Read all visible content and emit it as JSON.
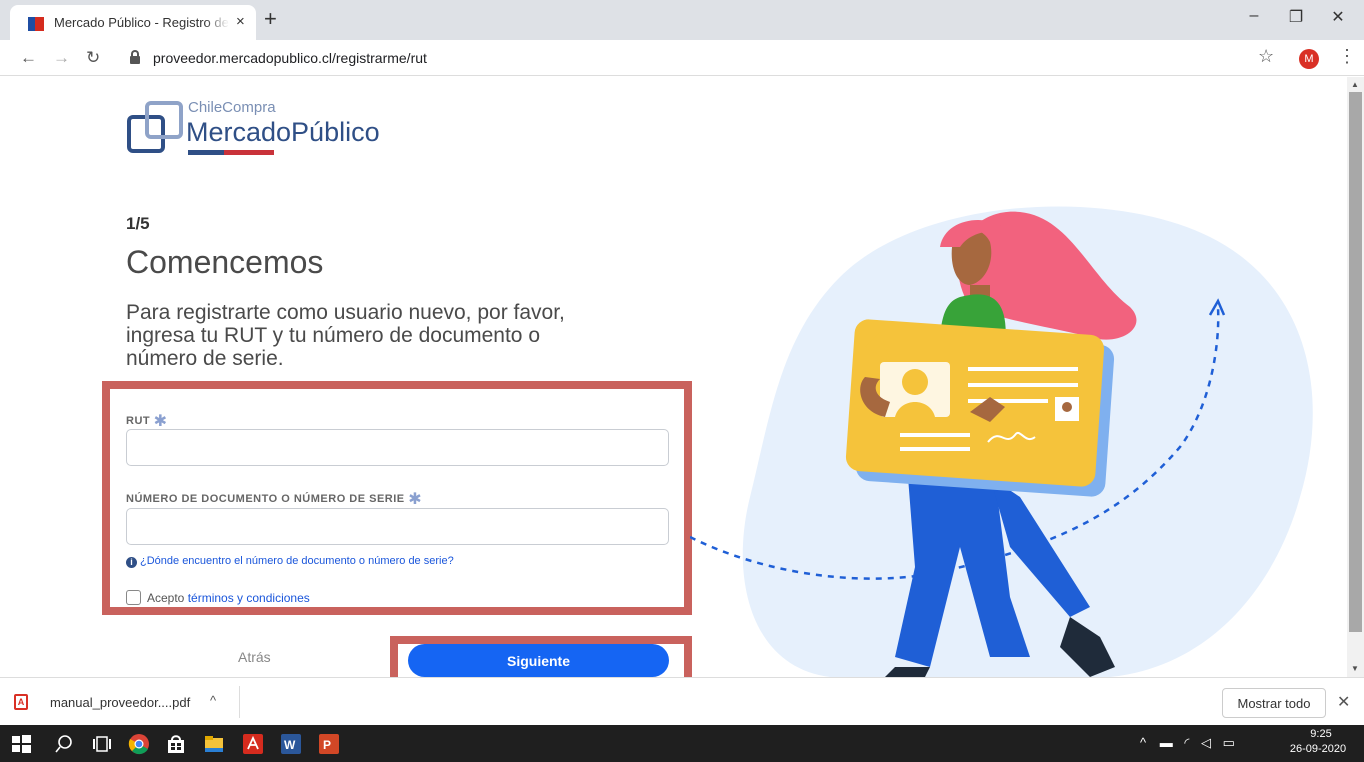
{
  "browser": {
    "tab_title": "Mercado Público - Registro de proveedores",
    "tab_close": "×",
    "new_tab": "+",
    "url": "proveedor.mercadopublico.cl/registrarme/rut",
    "avatar_letter": "M",
    "window_controls": {
      "minimize": "–",
      "restore": "❐",
      "close": "✕"
    },
    "nav": {
      "back": "←",
      "forward": "→",
      "reload": "↻",
      "bookmark": "☆",
      "menu": "⋮"
    },
    "icons": [
      "back-arrow-icon",
      "forward-arrow-icon",
      "reload-icon",
      "lock-icon",
      "star-icon",
      "kebab-menu-icon"
    ]
  },
  "logo": {
    "small": "ChileCompra",
    "big": "MercadoPúblico",
    "colors": {
      "blue": "#2f4f86",
      "red": "#c9323a"
    }
  },
  "form": {
    "step": "1/5",
    "heading": "Comencemos",
    "intro": "Para registrarte como usuario nuevo, por favor, ingresa tu RUT y tu número de documento o número de serie.",
    "rut_label": "RUT",
    "rut_value": "",
    "doc_label": "NÚMERO DE DOCUMENTO O NÚMERO DE SERIE",
    "doc_value": "",
    "required_mark": "✱",
    "help_icon": "i",
    "help_link": "¿Dónde encuentro el número de documento o número de serie?",
    "terms_prefix": "Acepto",
    "terms_link": "términos y condiciones",
    "terms_checked": false,
    "back_label": "Atrás",
    "next_label": "Siguiente",
    "highlight_color": "#c9625d",
    "primary_color": "#1565f3"
  },
  "downloads": {
    "file_name": "manual_proveedor....pdf",
    "file_icon": "pdf-file-icon",
    "chevron": "^",
    "show_all": "Mostrar todo",
    "close": "✕"
  },
  "taskbar": {
    "icons": [
      "windows-start-icon",
      "search-icon",
      "task-view-icon",
      "chrome-icon",
      "store-icon",
      "file-explorer-icon",
      "acrobat-icon",
      "word-icon",
      "powerpoint-icon"
    ],
    "tray_text": "^",
    "time": "9:25",
    "date": "26-09-2020"
  }
}
